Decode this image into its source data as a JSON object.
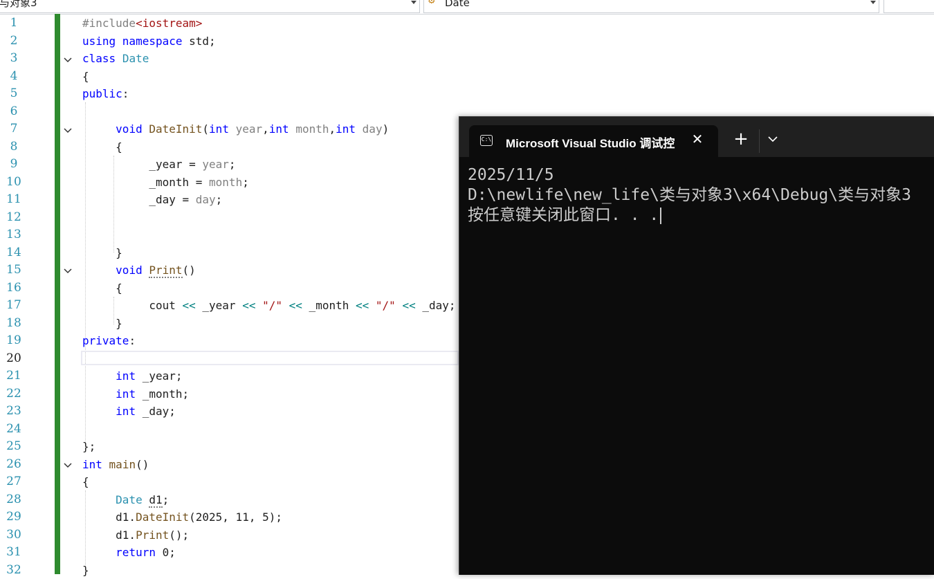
{
  "topbar": {
    "project_combo": "与对象3",
    "class_combo": "Date"
  },
  "editor": {
    "line_numbers": [
      "1",
      "2",
      "3",
      "4",
      "5",
      "6",
      "7",
      "8",
      "9",
      "10",
      "11",
      "12",
      "13",
      "14",
      "15",
      "16",
      "17",
      "18",
      "19",
      "20",
      "21",
      "22",
      "23",
      "24",
      "25",
      "26",
      "27",
      "28",
      "29",
      "30",
      "31",
      "32"
    ],
    "current_line": "20",
    "fold_markers_at_lines": [
      3,
      7,
      15,
      26
    ]
  },
  "terminal": {
    "tab_title": "Microsoft Visual Studio 调试控",
    "tab_icon_text": "C:\\",
    "output_lines": [
      "2025/11/5",
      "D:\\newlife\\new_life\\类与对象3\\x64\\Debug\\类与对象3",
      "按任意键关闭此窗口. . ."
    ]
  },
  "colors": {
    "keyword": "#0000ff",
    "type": "#2b91af",
    "change_bar": "#2e8b2e",
    "terminal_bg": "#0c0c0c",
    "terminal_tabbar": "#202020"
  },
  "icons": {
    "tab_icon": "console-icon",
    "close": "close-icon",
    "new_tab": "plus-icon",
    "dropdown": "chevron-down-icon",
    "class_combo_icon": "class-icon"
  }
}
